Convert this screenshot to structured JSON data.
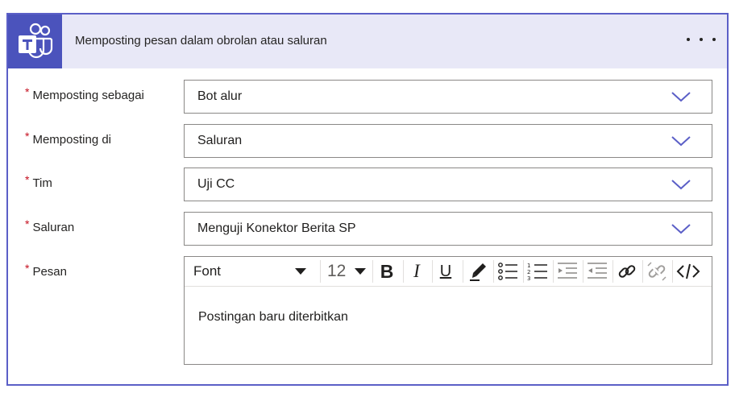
{
  "card": {
    "title": "Memposting pesan dalam obrolan atau saluran",
    "icon": "teams-logo-icon",
    "more_icon": "more-options-icon"
  },
  "fields": [
    {
      "label": "Memposting sebagai",
      "value": "Bot alur",
      "required": true
    },
    {
      "label": "Memposting di",
      "value": "Saluran",
      "required": true
    },
    {
      "label": "Tim",
      "value": "Uji CC",
      "required": true
    },
    {
      "label": "Saluran",
      "value": "Menguji Konektor Berita SP",
      "required": true
    }
  ],
  "message": {
    "label": "Pesan",
    "required": true,
    "required_mark": "*",
    "font_label": "Font",
    "font_size": "12",
    "content": "Postingan baru diterbitkan",
    "toolbar_icons": [
      "bold-icon",
      "italic-icon",
      "underline-icon",
      "highlight-pen-icon",
      "bullet-list-icon",
      "numbered-list-icon",
      "decrease-indent-icon",
      "increase-indent-icon",
      "link-icon",
      "unlink-icon",
      "code-view-icon"
    ]
  },
  "colors": {
    "accent": "#5b5fc7",
    "teams": "#4b53bc",
    "header_bg": "#e8e8f7",
    "required": "#c50f1f"
  }
}
